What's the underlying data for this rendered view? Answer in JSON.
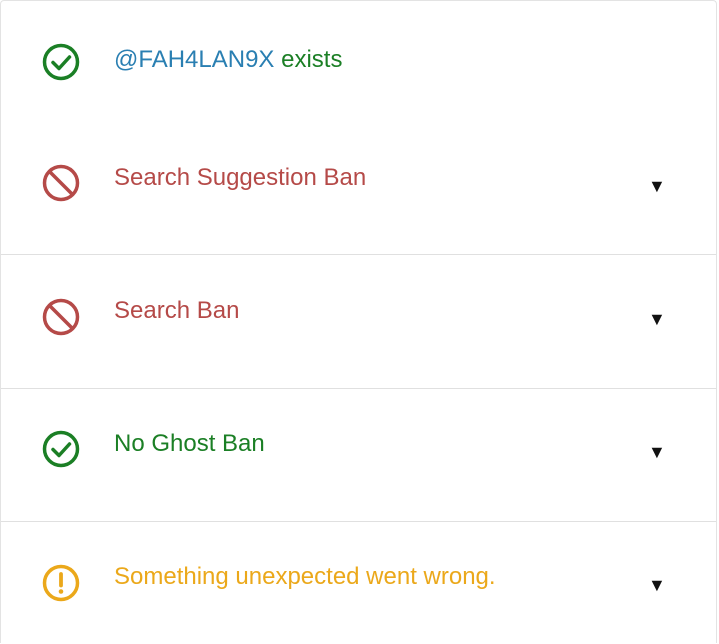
{
  "colors": {
    "success": "#1b7f25",
    "danger": "#b54a48",
    "warning": "#eba81a",
    "handle": "#2a7fb2"
  },
  "exists": {
    "handle": "@FAH4LAN9X",
    "suffix": " exists",
    "icon": "check-circle-icon"
  },
  "checks": [
    {
      "label": "Search Suggestion Ban",
      "status": "danger",
      "icon": "ban-icon"
    },
    {
      "label": "Search Ban",
      "status": "danger",
      "icon": "ban-icon"
    },
    {
      "label": "No Ghost Ban",
      "status": "success",
      "icon": "check-circle-icon"
    },
    {
      "label": "Something unexpected went wrong.",
      "status": "warning",
      "icon": "exclamation-circle-icon"
    }
  ],
  "expand_glyph": "▼"
}
